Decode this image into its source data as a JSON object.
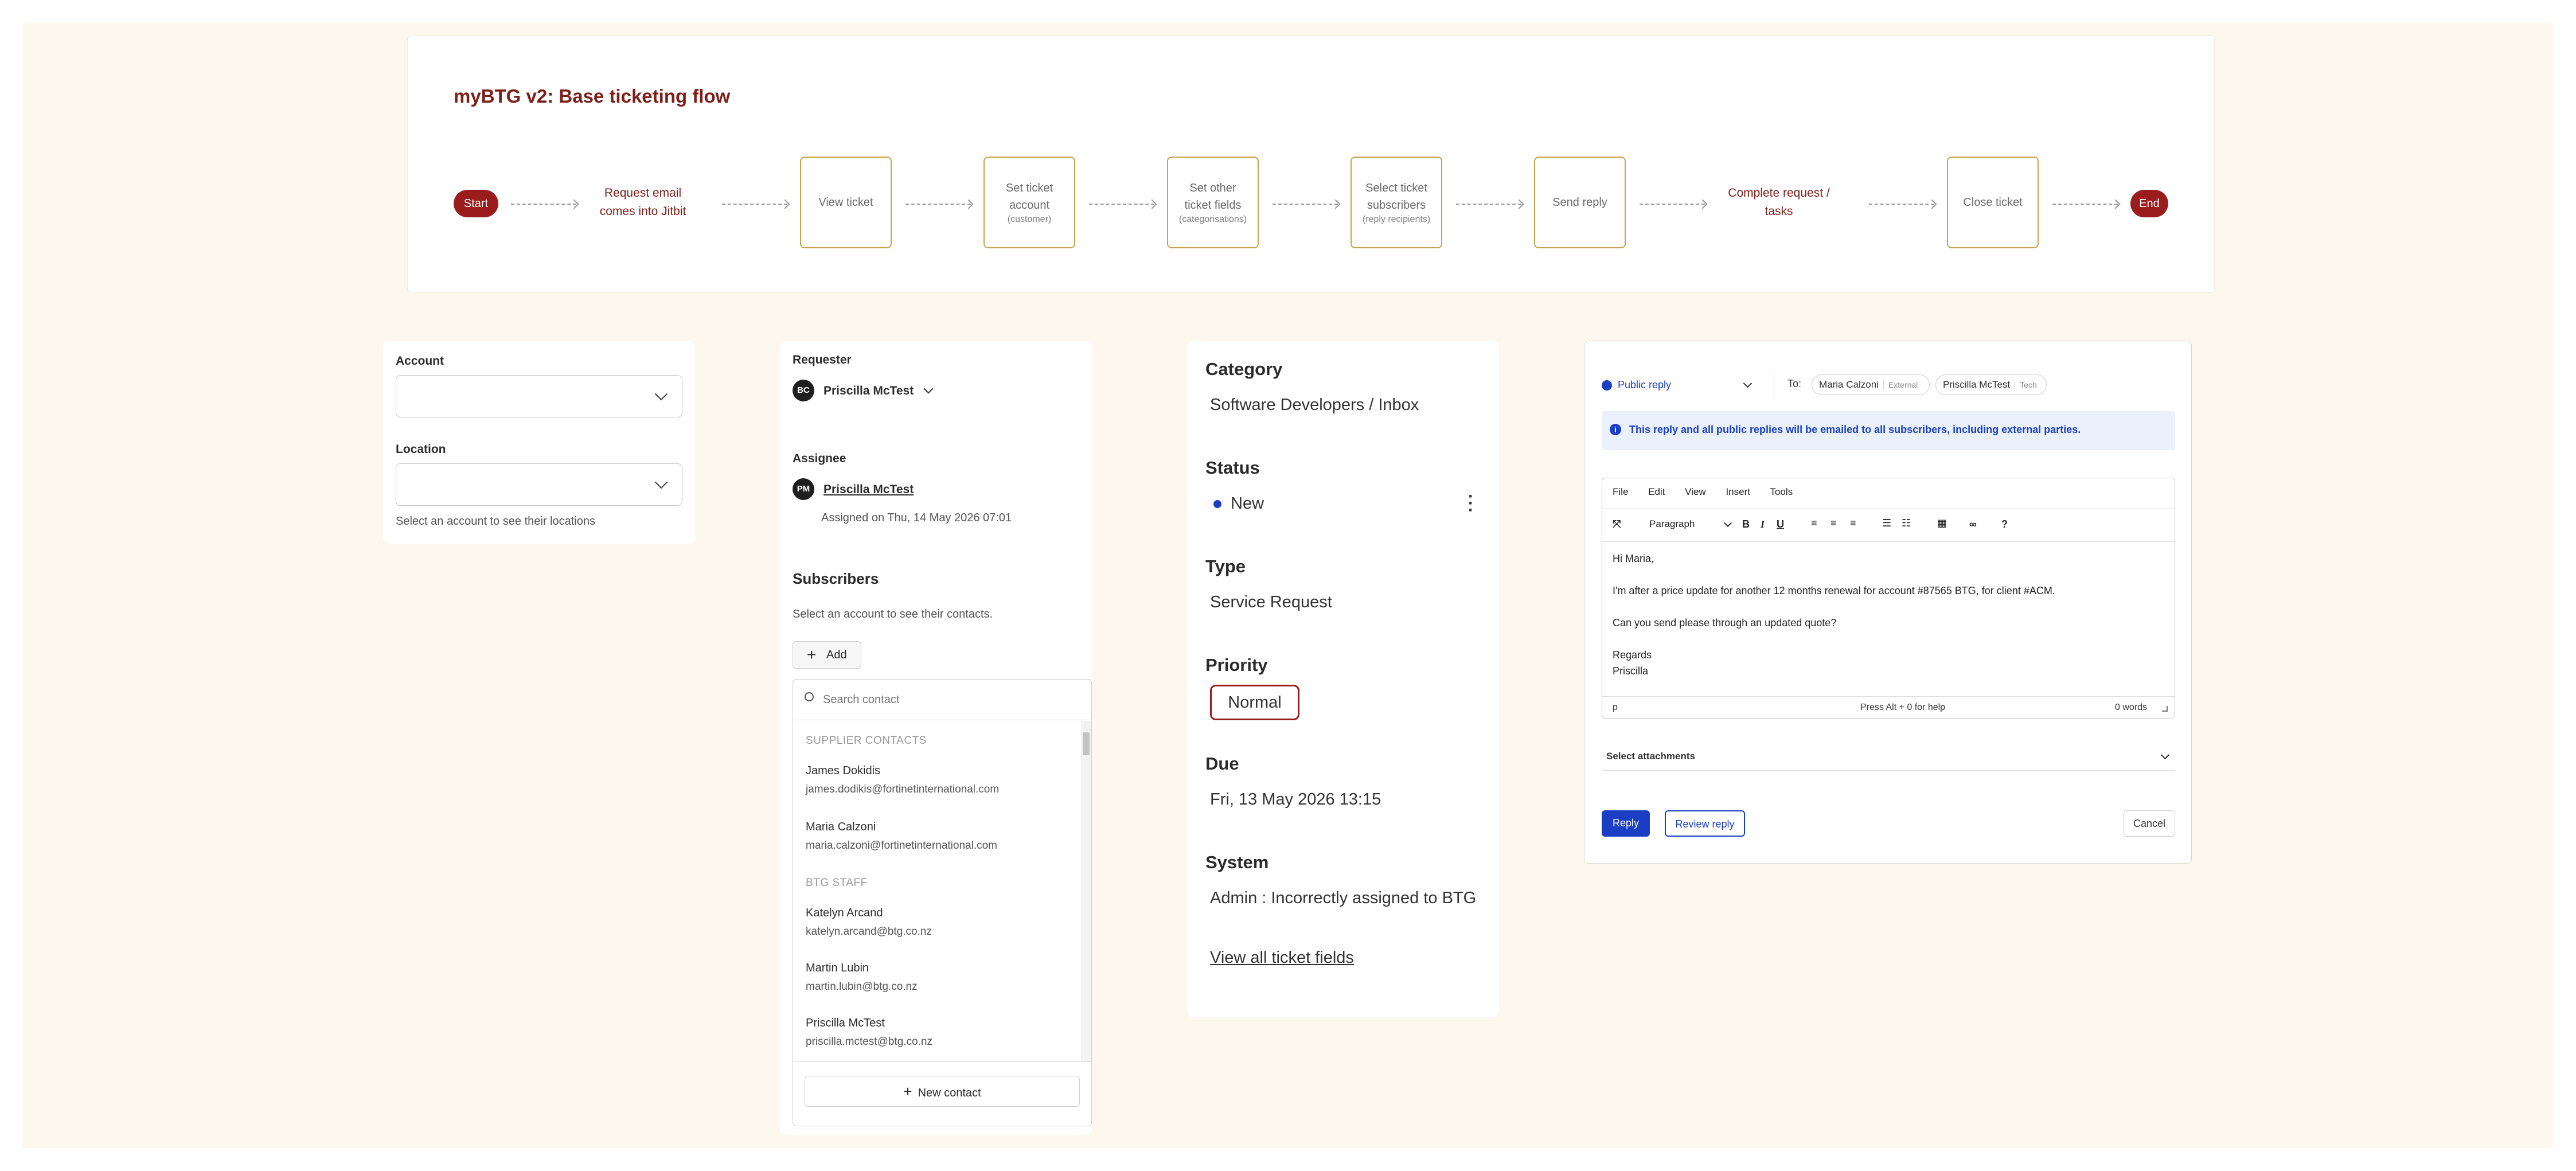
{
  "flow": {
    "title": "myBTG v2: Base ticketing flow",
    "start": "Start",
    "end": "End",
    "step_request_line1": "Request email",
    "step_request_line2": "comes into Jitbit",
    "step_view": "View ticket",
    "step_account_l1": "Set ticket",
    "step_account_l2": "account",
    "step_account_sub": "(customer)",
    "step_fields_l1": "Set other",
    "step_fields_l2": "ticket fields",
    "step_fields_sub": "(categorisations)",
    "step_subs_l1": "Select ticket",
    "step_subs_l2": "subscribers",
    "step_subs_sub": "(reply recipients)",
    "step_send": "Send reply",
    "step_complete_l1": "Complete request /",
    "step_complete_l2": "tasks",
    "step_close": "Close ticket"
  },
  "account_panel": {
    "account_label": "Account",
    "location_label": "Location",
    "location_hint": "Select an account to see their locations"
  },
  "people_panel": {
    "requester_label": "Requester",
    "requester_initials": "BC",
    "requester_name": "Priscilla McTest",
    "assignee_label": "Assignee",
    "assignee_initials": "PM",
    "assignee_name": "Priscilla McTest",
    "assigned_on": "Assigned on Thu, 14 May 2026 07:01",
    "subscribers_heading": "Subscribers",
    "subscribers_hint": "Select an account to see their contacts.",
    "add_button": "Add",
    "search_placeholder": "Search contact",
    "groups": [
      {
        "label": "SUPPLIER CONTACTS",
        "contacts": [
          {
            "name": "James Dokidis",
            "email": "james.dodikis@fortinetinternational.com"
          },
          {
            "name": "Maria Calzoni",
            "email": "maria.calzoni@fortinetinternational.com"
          }
        ]
      },
      {
        "label": "BTG STAFF",
        "contacts": [
          {
            "name": "Katelyn Arcand",
            "email": "katelyn.arcand@btg.co.nz"
          },
          {
            "name": "Martin Lubin",
            "email": "martin.lubin@btg.co.nz"
          },
          {
            "name": "Priscilla McTest",
            "email": "priscilla.mctest@btg.co.nz"
          }
        ]
      }
    ],
    "new_contact_button": "New contact"
  },
  "fields_panel": {
    "category_label": "Category",
    "category_value": "Software Developers / Inbox",
    "status_label": "Status",
    "status_value": "New",
    "status_color": "#1a3fc4",
    "type_label": "Type",
    "type_value": "Service Request",
    "priority_label": "Priority",
    "priority_value": "Normal",
    "due_label": "Due",
    "due_value": "Fri, 13 May 2026 13:15",
    "system_label": "System",
    "system_value": "Admin : Incorrectly assigned to BTG",
    "view_all_link": "View all ticket fields"
  },
  "reply_panel": {
    "mode": "Public reply",
    "to_label": "To:",
    "recipients": [
      {
        "name": "Maria Calzoni",
        "tag": "External"
      },
      {
        "name": "Priscilla McTest",
        "tag": "Tech"
      }
    ],
    "notice": "This reply and all public replies will be emailed to all subscribers, including external parties.",
    "menu": [
      "File",
      "Edit",
      "View",
      "Insert",
      "Tools"
    ],
    "format_select": "Paragraph",
    "body": {
      "greeting": "Hi Maria,",
      "line1": "I'm after a price update for another 12 months renewal for account #87565 BTG, for client #ACM.",
      "line2": "Can you send please through an updated quote?",
      "signoff1": "Regards",
      "signoff2": "Priscilla"
    },
    "status_path": "p",
    "help_text": "Press Alt + 0 for help",
    "word_count": "0 words",
    "attachments": "Select attachments",
    "reply_button": "Reply",
    "review_button": "Review reply",
    "cancel_button": "Cancel",
    "accent_color": "#1a3fc4"
  }
}
